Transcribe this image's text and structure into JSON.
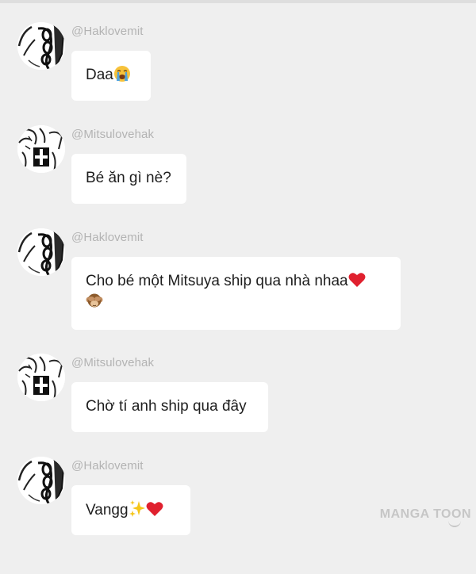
{
  "messages": [
    {
      "username": "@Haklovemit",
      "text": "Daa",
      "emoji": [
        "loudly-crying-face"
      ]
    },
    {
      "username": "@Mitsulovehak",
      "text": "Bé ăn gì nè?",
      "emoji": []
    },
    {
      "username": "@Haklovemit",
      "text": "Cho bé một Mitsuya ship qua nhà nhaa",
      "emoji": [
        "red-heart",
        "see-no-evil-monkey"
      ]
    },
    {
      "username": "@Mitsulovehak",
      "text": "Chờ tí anh ship qua đây",
      "emoji": []
    },
    {
      "username": "@Haklovemit",
      "text": "Vangg",
      "emoji": [
        "sparkles",
        "red-heart"
      ]
    }
  ],
  "watermark": "MANGA TOON",
  "colors": {
    "background": "#efefef",
    "bubble": "#ffffff",
    "username": "#b3b3b3",
    "text": "#1e1e1e",
    "heart": "#e0202e",
    "watermark": "#c6c6c6"
  }
}
